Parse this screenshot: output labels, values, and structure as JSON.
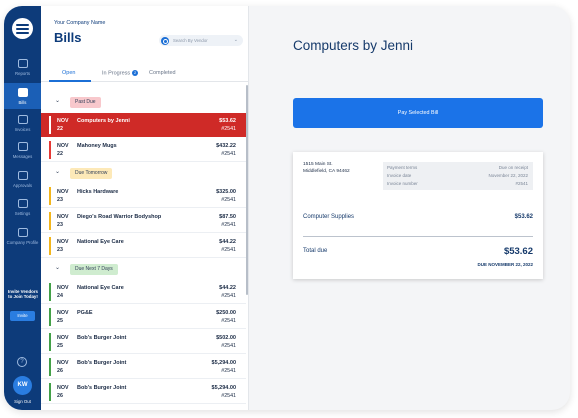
{
  "rail": {
    "items": [
      {
        "label": "Reports",
        "icon": "reports-icon"
      },
      {
        "label": "Bills",
        "icon": "bills-icon",
        "active": true
      },
      {
        "label": "Invoices",
        "icon": "invoices-icon"
      },
      {
        "label": "Messages",
        "icon": "messages-icon"
      },
      {
        "label": "Approvals",
        "icon": "approvals-icon"
      },
      {
        "label": "Settings",
        "icon": "settings-icon"
      },
      {
        "label": "Company Profile",
        "icon": "company-profile-icon"
      }
    ],
    "invite_text": "Invite Vendors to Join Today!",
    "invite_button": "Invite",
    "help_glyph": "?",
    "avatar_initials": "KW",
    "signout_label": "Sign Out"
  },
  "header": {
    "company_name": "Your Company Name",
    "title": "Bills",
    "search_placeholder": "Search By Vendor"
  },
  "tabs": [
    {
      "label": "Open",
      "active": true
    },
    {
      "label": "In Progress",
      "badge": "2"
    },
    {
      "label": "Completed"
    }
  ],
  "groups": [
    {
      "label": "Past Due",
      "color": "#f8c8cc",
      "bar_color": "#e53935",
      "bills": [
        {
          "month": "NOV",
          "day": "22",
          "vendor": "Computers by Jenni",
          "amount": "$53.62",
          "number": "#2541",
          "selected": true
        },
        {
          "month": "NOV",
          "day": "22",
          "vendor": "Mahoney Mugs",
          "amount": "$432.22",
          "number": "#2541"
        }
      ]
    },
    {
      "label": "Due Tomorrow",
      "color": "#fde9b8",
      "bar_color": "#f2b51c",
      "bills": [
        {
          "month": "NOV",
          "day": "23",
          "vendor": "Hicks Hardware",
          "amount": "$325.00",
          "number": "#2541"
        },
        {
          "month": "NOV",
          "day": "23",
          "vendor": "Diego's Road Warrior Bodyshop",
          "amount": "$87.50",
          "number": "#2541"
        },
        {
          "month": "NOV",
          "day": "23",
          "vendor": "National Eye Care",
          "amount": "$44.22",
          "number": "#2541"
        }
      ]
    },
    {
      "label": "Due Next 7 Days",
      "color": "#cfeccf",
      "bar_color": "#43a047",
      "bills": [
        {
          "month": "NOV",
          "day": "24",
          "vendor": "National Eye Care",
          "amount": "$44.22",
          "number": "#2541"
        },
        {
          "month": "NOV",
          "day": "25",
          "vendor": "PG&E",
          "amount": "$250.00",
          "number": "#2541"
        },
        {
          "month": "NOV",
          "day": "25",
          "vendor": "Bob's Burger Joint",
          "amount": "$502.00",
          "number": "#2541"
        },
        {
          "month": "NOV",
          "day": "26",
          "vendor": "Bob's Burger Joint",
          "amount": "$5,294.00",
          "number": "#2541"
        },
        {
          "month": "NOV",
          "day": "26",
          "vendor": "Bob's Burger Joint",
          "amount": "$5,294.00",
          "number": "#2541"
        }
      ]
    }
  ],
  "detail": {
    "vendor": "Computers by Jenni",
    "pay_button": "Pay Selected Bill",
    "address_line1": "1515 Main St.",
    "address_line2": "Middlefield, CA 94462",
    "terms": [
      {
        "key": "Payment terms",
        "value": "Due on receipt"
      },
      {
        "key": "Invoice date",
        "value": "November 22, 2022"
      },
      {
        "key": "Invoice number",
        "value": "#2541"
      }
    ],
    "line_item": "Computer Supplies",
    "line_amount": "$53.62",
    "total_label": "Total due",
    "total_amount": "$53.62",
    "due_text": "DUE NOVEMBER 22, 2022"
  },
  "colors": {
    "rail": "#0d3b7a",
    "accent": "#1b73e8",
    "selected_row": "#cf2a27"
  }
}
